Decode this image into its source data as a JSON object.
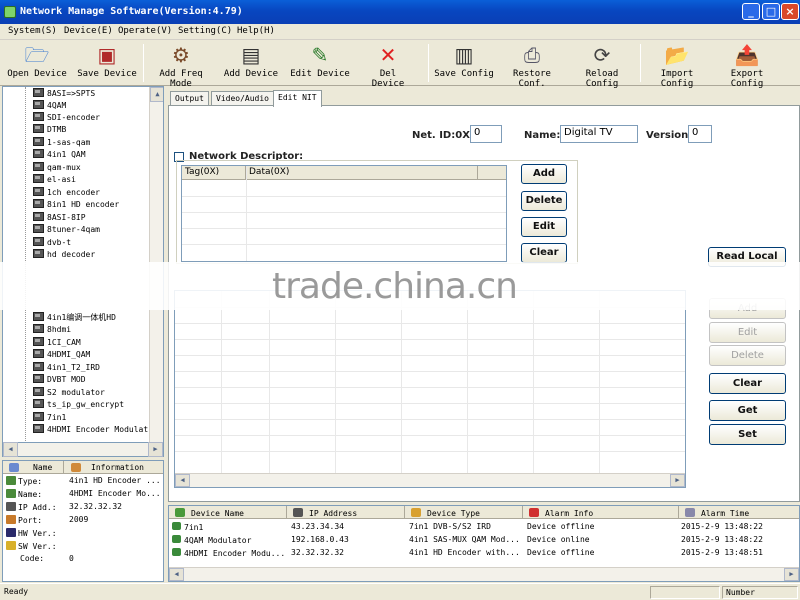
{
  "window": {
    "title": "Network Manage Software(Version:4.79)",
    "controls": {
      "minimize": "_",
      "maximize": "□",
      "close": "×"
    }
  },
  "menu": [
    "System(S)",
    "Device(E)",
    "Operate(V)",
    "Setting(C)",
    "Help(H)"
  ],
  "toolbar": [
    {
      "label": "Open Device",
      "icon": "folder-device-icon"
    },
    {
      "label": "Save Device",
      "icon": "save-device-icon"
    },
    {
      "label": "Add Freq Mode",
      "icon": "freq-mode-icon"
    },
    {
      "label": "Add Device",
      "icon": "add-device-icon"
    },
    {
      "label": "Edit Device",
      "icon": "edit-device-icon"
    },
    {
      "label": "Del Device",
      "icon": "delete-icon"
    },
    {
      "label": "Save Config",
      "icon": "save-config-icon"
    },
    {
      "label": "Restore Conf.",
      "icon": "restore-config-icon"
    },
    {
      "label": "Reload Config",
      "icon": "reload-config-icon"
    },
    {
      "label": "Import Config",
      "icon": "import-config-icon"
    },
    {
      "label": "Export Config",
      "icon": "export-config-icon"
    }
  ],
  "tree": {
    "items_top": [
      "8ASI=>SPTS",
      "4QAM",
      "SDI-encoder",
      "DTMB",
      "1-sas-qam",
      "4in1 QAM",
      "qam-mux",
      "el-asi",
      "1ch encoder",
      "8in1 HD encoder",
      "8ASI-8IP",
      "8tuner-4qam",
      "dvb-t",
      "hd decoder"
    ],
    "items_bottom": [
      "4in1编调一体机HD",
      "8hdmi",
      "1CI_CAM",
      "4HDMI_QAM",
      "4in1_T2_IRD",
      "DVBT MOD",
      "S2 modulator",
      "ts_ip_gw_encrypt",
      "7in1",
      "4HDMI Encoder Modulat"
    ]
  },
  "info_panel": {
    "headers": [
      "Name",
      "Information"
    ],
    "rows": [
      {
        "key": "Type:",
        "value": "4in1 HD Encoder ..."
      },
      {
        "key": "Name:",
        "value": "4HDMI Encoder Mo..."
      },
      {
        "key": "IP Add.:",
        "value": "32.32.32.32"
      },
      {
        "key": "Port:",
        "value": "2009"
      },
      {
        "key": "HW Ver.:",
        "value": ""
      },
      {
        "key": "SW Ver.:",
        "value": ""
      },
      {
        "key": "Code:",
        "value": "0"
      }
    ]
  },
  "tabs": [
    "Output",
    "Video/Audio",
    "Edit NIT"
  ],
  "nit": {
    "net_id_label": "Net. ID:0X",
    "net_id_value": "0",
    "name_label": "Name:",
    "name_value": "Digital TV",
    "version_label": "Version",
    "version_value": "0",
    "network_descriptor_label": "Network Descriptor:",
    "descriptor_checked": false,
    "descriptor_columns": [
      "Tag(0X)",
      "Data(0X)"
    ],
    "descriptor_buttons": [
      "Add",
      "Delete",
      "Edit",
      "Clear"
    ],
    "right_buttons": [
      {
        "label": "Read Local",
        "enabled": true
      },
      {
        "label": "Add",
        "enabled": false
      },
      {
        "label": "Edit",
        "enabled": false
      },
      {
        "label": "Delete",
        "enabled": false
      },
      {
        "label": "Clear",
        "enabled": true
      },
      {
        "label": "Get",
        "enabled": true
      },
      {
        "label": "Set",
        "enabled": true
      }
    ]
  },
  "watermark": "trade.china.cn",
  "device_list": {
    "columns": [
      "Device Name",
      "IP Address",
      "Device Type",
      "Alarm Info",
      "Alarm Time"
    ],
    "rows": [
      [
        "7in1",
        "43.23.34.34",
        "7in1 DVB-S/S2 IRD",
        "Device offline",
        "2015-2-9 13:48:22"
      ],
      [
        "4QAM Modulator",
        "192.168.0.43",
        "4in1 SAS-MUX QAM Mod...",
        "Device online",
        "2015-2-9 13:48:22"
      ],
      [
        "4HDMI Encoder Modu...",
        "32.32.32.32",
        "4in1 HD Encoder with...",
        "Device offline",
        "2015-2-9 13:48:51"
      ]
    ]
  },
  "status": {
    "left": "Ready",
    "right": "Number"
  }
}
